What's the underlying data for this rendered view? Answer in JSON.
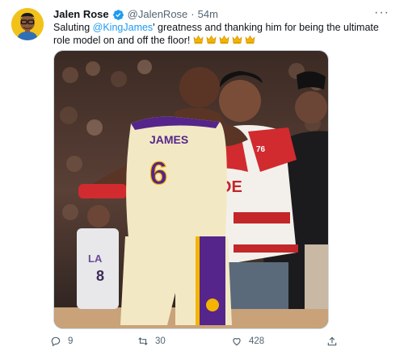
{
  "tweet": {
    "author": {
      "display_name": "Jalen Rose",
      "handle": "@JalenRose",
      "verified_icon": "verified-badge-icon",
      "avatar_icon": "avatar-icon"
    },
    "separator": "·",
    "timestamp": "54m",
    "text": {
      "part1": "Saluting ",
      "mention": "@KingJames",
      "part2": "' greatness and thanking him for being the ultimate role model on and off the floor! "
    },
    "emoji": [
      "crown",
      "crown",
      "crown",
      "crown",
      "crown"
    ],
    "media": {
      "jersey_name": "JAMES",
      "jersey_number": "6",
      "jacket_text": "DE",
      "jacket_patch": "76"
    },
    "actions": {
      "reply_count": "9",
      "retweet_count": "30",
      "like_count": "428"
    }
  },
  "colors": {
    "accent": "#1d9bf0",
    "text_primary": "#0f1419",
    "text_secondary": "#536471",
    "lakers_gold": "#f3e6a3",
    "lakers_purple": "#55258b"
  }
}
